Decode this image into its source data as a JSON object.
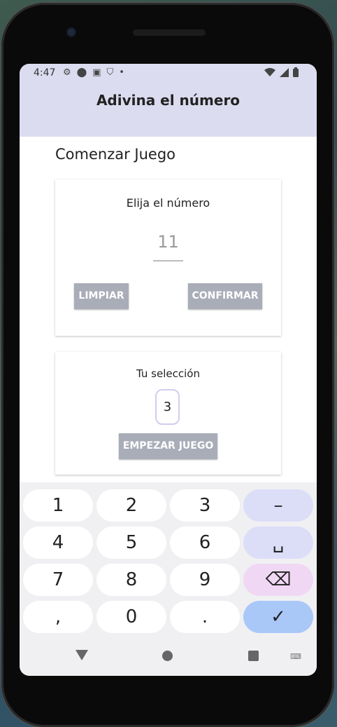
{
  "status": {
    "time": "4:47"
  },
  "app": {
    "title": "Adivina el número"
  },
  "start_section": {
    "title": "Comenzar Juego"
  },
  "pick_card": {
    "label": "Elija el número",
    "input_placeholder": "11",
    "clear_label": "LIMPIAR",
    "confirm_label": "CONFIRMAR"
  },
  "selection_card": {
    "label": "Tu selección",
    "value": "3",
    "start_label": "EMPEZAR JUEGO"
  },
  "keyboard": {
    "row1": [
      "1",
      "2",
      "3",
      "–"
    ],
    "row2": [
      "4",
      "5",
      "6",
      "␣"
    ],
    "row3": [
      "7",
      "8",
      "9",
      "⌫"
    ],
    "row4": [
      ",",
      "0",
      ".",
      "✓"
    ]
  },
  "colors": {
    "header_bg": "#dcdcf0",
    "button_bg": "#a9adb8",
    "confirm_key": "#a9c8f8"
  }
}
